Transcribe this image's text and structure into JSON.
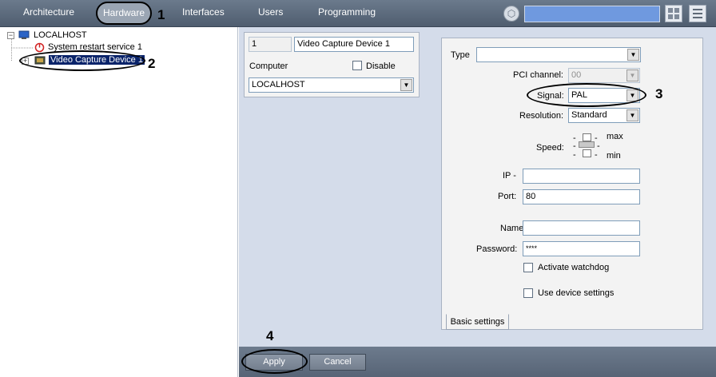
{
  "top_tabs": [
    "Architecture",
    "Hardware",
    "Interfaces",
    "Users",
    "Programming"
  ],
  "steps": [
    "1",
    "2",
    "3",
    "4"
  ],
  "tree": {
    "root": "LOCALHOST",
    "children": [
      "System restart service 1",
      "Video Capture Device 1"
    ],
    "expander_root": "−",
    "expander_child": "+"
  },
  "device": {
    "id": "1",
    "name": "Video Capture Device 1",
    "computer_label": "Computer",
    "disable_label": "Disable",
    "computer_value": "LOCALHOST"
  },
  "settings": {
    "type_label": "Type",
    "type_value": "",
    "pci_label": "PCI channel:",
    "pci_value": "00",
    "signal_label": "Signal:",
    "signal_value": "PAL",
    "resolution_label": "Resolution:",
    "resolution_value": "Standard",
    "speed_label": "Speed:",
    "speed_max": "max",
    "speed_min": "min",
    "ip_label": "IP -",
    "ip_value": "",
    "port_label": "Port:",
    "port_value": "80",
    "name_label": "Name:",
    "name_value": "",
    "password_label": "Password:",
    "password_value": "****",
    "watchdog_label": "Activate watchdog",
    "device_settings_label": "Use device settings",
    "tab_label": "Basic settings"
  },
  "buttons": {
    "apply": "Apply",
    "cancel": "Cancel"
  },
  "icons": {
    "search_hex": "hexagon-icon",
    "layout": "grid-icon",
    "menu": "menu-icon"
  },
  "colors": {
    "topbar": "#5f6d80",
    "search": "#6f99df",
    "panel": "#d4dcea"
  }
}
